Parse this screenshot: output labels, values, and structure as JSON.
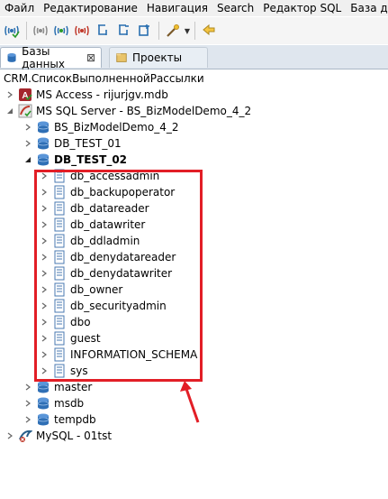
{
  "menu": [
    "Файл",
    "Редактирование",
    "Навигация",
    "Search",
    "Редактор SQL",
    "База данных"
  ],
  "tabs": [
    {
      "label": "Базы данных",
      "close": "⊠"
    },
    {
      "label": "Проекты"
    }
  ],
  "breadcrumb": "CRM.СписокВыполненнойРассылки",
  "tree": {
    "ms_access": "MS Access - rijurjgv.mdb",
    "ms_sql": "MS SQL Server - BS_BizModelDemo_4_2",
    "databases": [
      "BS_BizModelDemo_4_2",
      "DB_TEST_01",
      "DB_TEST_02"
    ],
    "schemas": [
      "db_accessadmin",
      "db_backupoperator",
      "db_datareader",
      "db_datawriter",
      "db_ddladmin",
      "db_denydatareader",
      "db_denydatawriter",
      "db_owner",
      "db_securityadmin",
      "dbo",
      "guest",
      "INFORMATION_SCHEMA",
      "sys"
    ],
    "system_dbs": [
      "master",
      "msdb",
      "tempdb"
    ],
    "mysql": "MySQL - 01tst"
  },
  "colors": {
    "highlight": "#e21e26",
    "db_icon": "#2f6fb5"
  }
}
